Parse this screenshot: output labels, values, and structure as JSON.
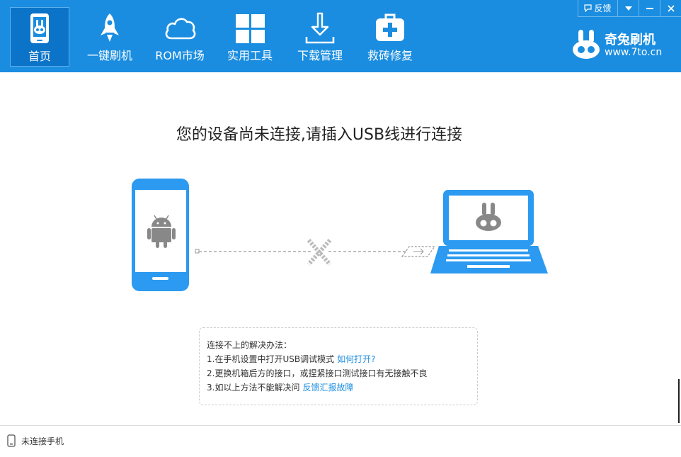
{
  "nav": {
    "items": [
      {
        "label": "首页",
        "icon": "phone-rabbit-icon"
      },
      {
        "label": "一键刷机",
        "icon": "rocket-icon"
      },
      {
        "label": "ROM市场",
        "icon": "cloud-icon"
      },
      {
        "label": "实用工具",
        "icon": "grid-icon"
      },
      {
        "label": "下载管理",
        "icon": "download-icon"
      },
      {
        "label": "救砖修复",
        "icon": "medkit-icon"
      }
    ]
  },
  "brand": {
    "name": "奇兔刷机",
    "url": "www.7to.cn"
  },
  "window_controls": {
    "feedback": "反馈"
  },
  "main": {
    "headline": "您的设备尚未连接,请插入USB线进行连接"
  },
  "tips": {
    "title": "连接不上的解决办法：",
    "line1": "1.在手机设置中打开USB调试模式",
    "line1_link": "如何打开?",
    "line2": "2.更换机箱后方的接口，或捏紧接口测试接口有无接触不良",
    "line3": "3.如以上方法不能解决问",
    "line3_link": "反馈汇报故障"
  },
  "status": {
    "text": "未连接手机"
  },
  "colors": {
    "accent": "#1a8de0",
    "active": "#0b73c8",
    "illustration": "#2b9af0"
  }
}
